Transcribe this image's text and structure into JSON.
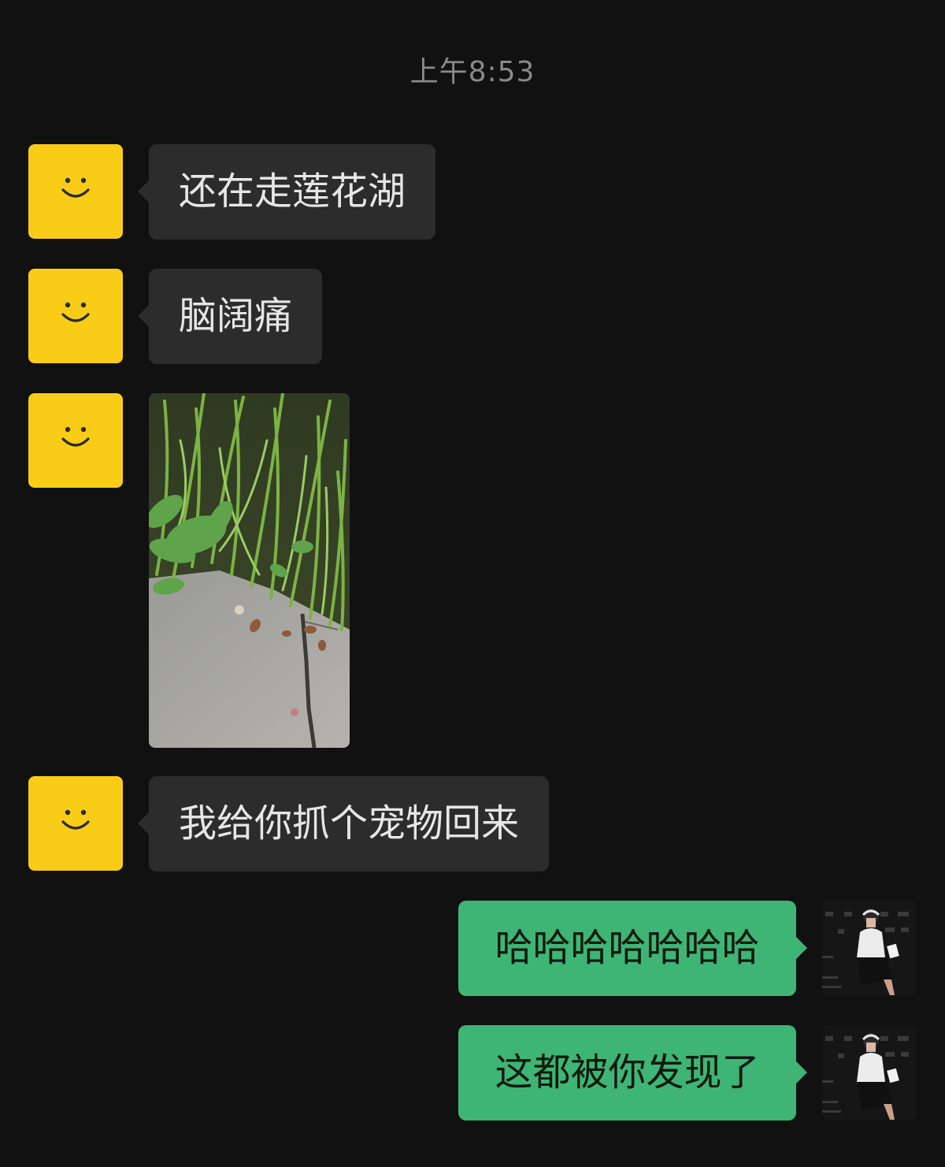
{
  "timestamp": "上午8:53",
  "messages": [
    {
      "side": "left",
      "type": "text",
      "text": "还在走莲花湖"
    },
    {
      "side": "left",
      "type": "text",
      "text": "脑阔痛"
    },
    {
      "side": "left",
      "type": "image",
      "image_description": "grass-and-pavement-photo"
    },
    {
      "side": "left",
      "type": "text",
      "text": "我给你抓个宠物回来"
    },
    {
      "side": "right",
      "type": "text",
      "text": "哈哈哈哈哈哈哈"
    },
    {
      "side": "right",
      "type": "text",
      "text": "这都被你发现了"
    }
  ],
  "colors": {
    "background": "#111111",
    "left_bubble": "#2c2c2c",
    "right_bubble": "#3eb575",
    "avatar_yellow": "#f9cd17"
  },
  "icons": {
    "contact_avatar": "smiley-face-icon",
    "self_avatar": "user-photo-avatar"
  }
}
